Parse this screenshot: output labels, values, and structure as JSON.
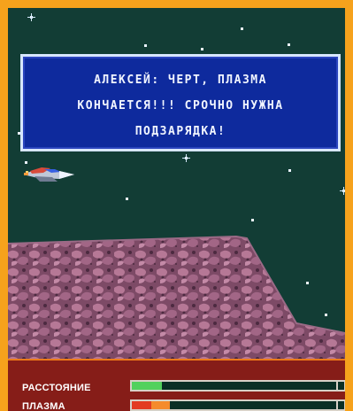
{
  "dialog": {
    "text": "АЛЕКСЕЙ: ЧЕРТ, ПЛАЗМА\nКОНЧАЕТСЯ!!! СРОЧНО НУЖНА\nПОДЗАРЯДКА!"
  },
  "hud": {
    "distance_label": "РАССТОЯНИЕ",
    "plasma_label": "ПЛАЗМА",
    "distance_progress": 0.18,
    "plasma_progress": 0.28
  },
  "colors": {
    "frame": "#f6a21c",
    "space": "#123d35",
    "dialog_bg": "#0e2a9d",
    "hud_bg": "#861d18",
    "distance_fill": "#52d15d",
    "plasma_red": "#e33b22",
    "plasma_orange": "#f58b2c"
  },
  "icons": [
    "star-icon",
    "spaceship-icon"
  ]
}
